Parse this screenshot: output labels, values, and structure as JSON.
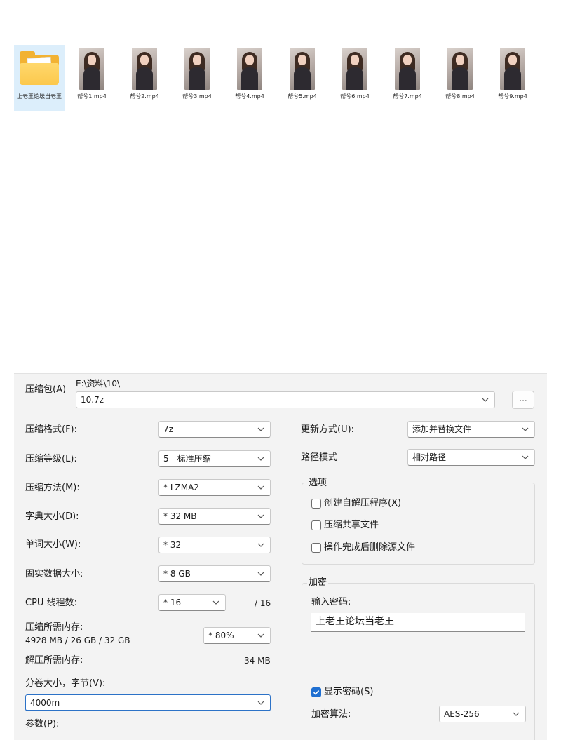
{
  "explorer": {
    "items": [
      {
        "name": "上老王论坛当老王",
        "type": "folder",
        "selected": true
      },
      {
        "name": "帮兮1.mp4",
        "type": "video"
      },
      {
        "name": "帮兮2.mp4",
        "type": "video"
      },
      {
        "name": "帮兮3.mp4",
        "type": "video"
      },
      {
        "name": "帮兮4.mp4",
        "type": "video"
      },
      {
        "name": "帮兮5.mp4",
        "type": "video"
      },
      {
        "name": "帮兮6.mp4",
        "type": "video"
      },
      {
        "name": "帮兮7.mp4",
        "type": "video"
      },
      {
        "name": "帮兮8.mp4",
        "type": "video"
      },
      {
        "name": "帮兮9.mp4",
        "type": "video"
      }
    ]
  },
  "dialog": {
    "archive": {
      "label": "压缩包(A)",
      "path": "E:\\资料\\10\\",
      "filename": "10.7z",
      "browse_label": "..."
    },
    "format": {
      "label": "压缩格式(F):",
      "value": "7z"
    },
    "level": {
      "label": "压缩等级(L):",
      "value": "5 - 标准压缩"
    },
    "method": {
      "label": "压缩方法(M):",
      "value": "* LZMA2"
    },
    "dict": {
      "label": "字典大小(D):",
      "value": "* 32 MB"
    },
    "word": {
      "label": "单词大小(W):",
      "value": "* 32"
    },
    "solid": {
      "label": "固实数据大小:",
      "value": "* 8 GB"
    },
    "threads": {
      "label": "CPU 线程数:",
      "value": "* 16",
      "max": "/ 16"
    },
    "mem_compress": {
      "label": "压缩所需内存:",
      "detail": "4928 MB / 26 GB / 32 GB",
      "value": "* 80%"
    },
    "mem_decompress": {
      "label": "解压所需内存:",
      "value": "34 MB"
    },
    "volume": {
      "label": "分卷大小，字节(V):",
      "value": "4000m"
    },
    "params": {
      "label": "参数(P):"
    },
    "update": {
      "label": "更新方式(U):",
      "value": "添加并替换文件"
    },
    "pathmode": {
      "label": "路径模式",
      "value": "相对路径"
    },
    "options": {
      "title": "选项",
      "sfx": {
        "label": "创建自解压程序(X)",
        "checked": false
      },
      "shared": {
        "label": "压缩共享文件",
        "checked": false
      },
      "delete": {
        "label": "操作完成后删除源文件",
        "checked": false
      }
    },
    "encryption": {
      "title": "加密",
      "pwd_label": "输入密码:",
      "pwd_value": "上老王论坛当老王",
      "show": {
        "label": "显示密码(S)",
        "checked": true
      },
      "algo_label": "加密算法:",
      "algo_value": "AES-256"
    }
  },
  "colors": {
    "accent": "#1f6fd1",
    "folder": "#f2b233",
    "selected_bg": "#dceefb",
    "dialog_bg": "#f3f3f3"
  }
}
